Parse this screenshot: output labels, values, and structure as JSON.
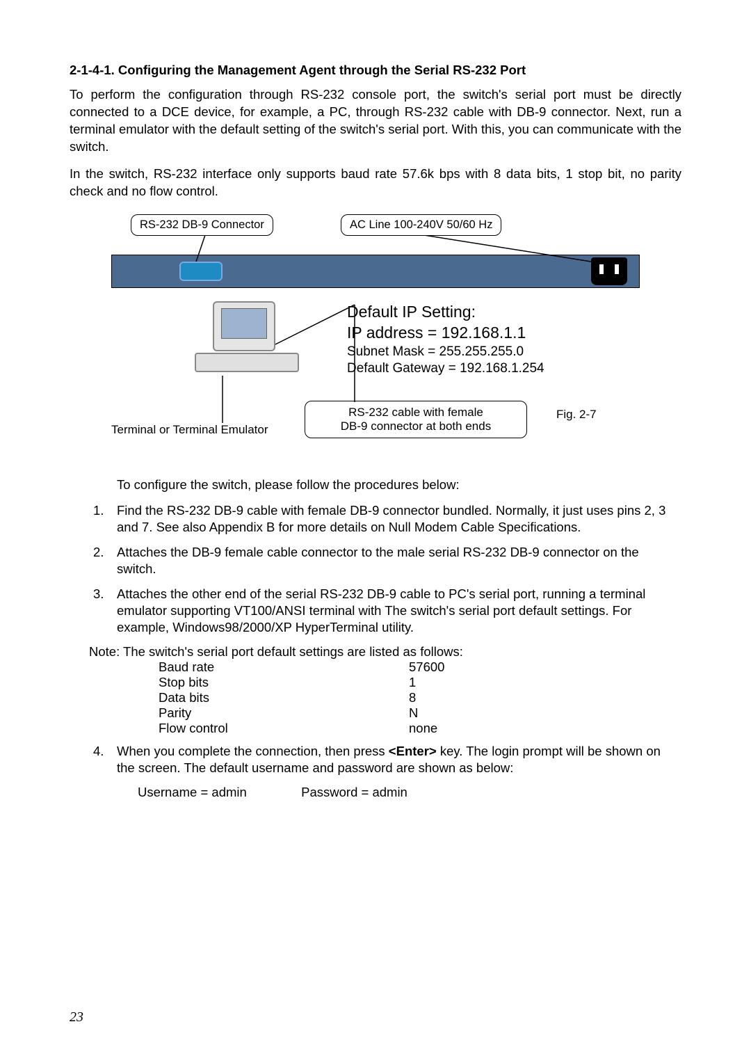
{
  "heading": "2-1-4-1. Configuring the Management Agent through the Serial RS-232 Port",
  "para1": "To perform the configuration through RS-232 console port, the switch's serial port must be directly connected to a DCE device, for example, a PC, through RS-232 cable with DB-9 connector. Next, run a terminal emulator with the default setting of the switch's serial port. With this, you can communicate with the switch.",
  "para2": "In the switch, RS-232 interface only supports baud rate 57.6k bps with 8 data bits, 1 stop bit, no parity check and no flow control.",
  "diagram": {
    "connector_label": "RS-232 DB-9 Connector",
    "ac_label": "AC Line 100-240V 50/60 Hz",
    "ip_title": "Default IP Setting:",
    "ip_addr": "IP address = 192.168.1.1",
    "subnet": "Subnet Mask = 255.255.255.0",
    "gateway": "Default Gateway = 192.168.1.254",
    "cable_l1": "RS-232 cable with female",
    "cable_l2": "DB-9 connector at both ends",
    "fig": "Fig. 2-7",
    "terminal": "Terminal or Terminal Emulator"
  },
  "intro": "To configure the switch, please follow the procedures below:",
  "steps": [
    "Find the RS-232 DB-9 cable with female DB-9 connector bundled. Normally, it just uses pins 2, 3 and 7. See also Appendix B for more details on Null Modem Cable Specifications.",
    "Attaches the DB-9 female cable connector to the male serial RS-232 DB-9 connector on the switch.",
    "Attaches the other end of the serial RS-232 DB-9 cable to PC's serial port, running a terminal emulator supporting VT100/ANSI terminal with The switch's serial port default settings.  For example, Windows98/2000/XP HyperTerminal utility."
  ],
  "note": "Note: The switch's serial port default settings are listed as follows:",
  "settings": [
    {
      "k": "Baud rate",
      "v": "57600"
    },
    {
      "k": "Stop bits",
      "v": "1"
    },
    {
      "k": "Data bits",
      "v": "8"
    },
    {
      "k": "Parity",
      "v": "N"
    },
    {
      "k": "Flow control",
      "v": "none"
    }
  ],
  "step4_pre": "When you complete the connection, then press ",
  "step4_bold": "<Enter>",
  "step4_post": " key. The login prompt will be shown on the screen. The default username and password are shown as below:",
  "creds": {
    "u": "Username = admin",
    "p": "Password = admin"
  },
  "page": "23"
}
